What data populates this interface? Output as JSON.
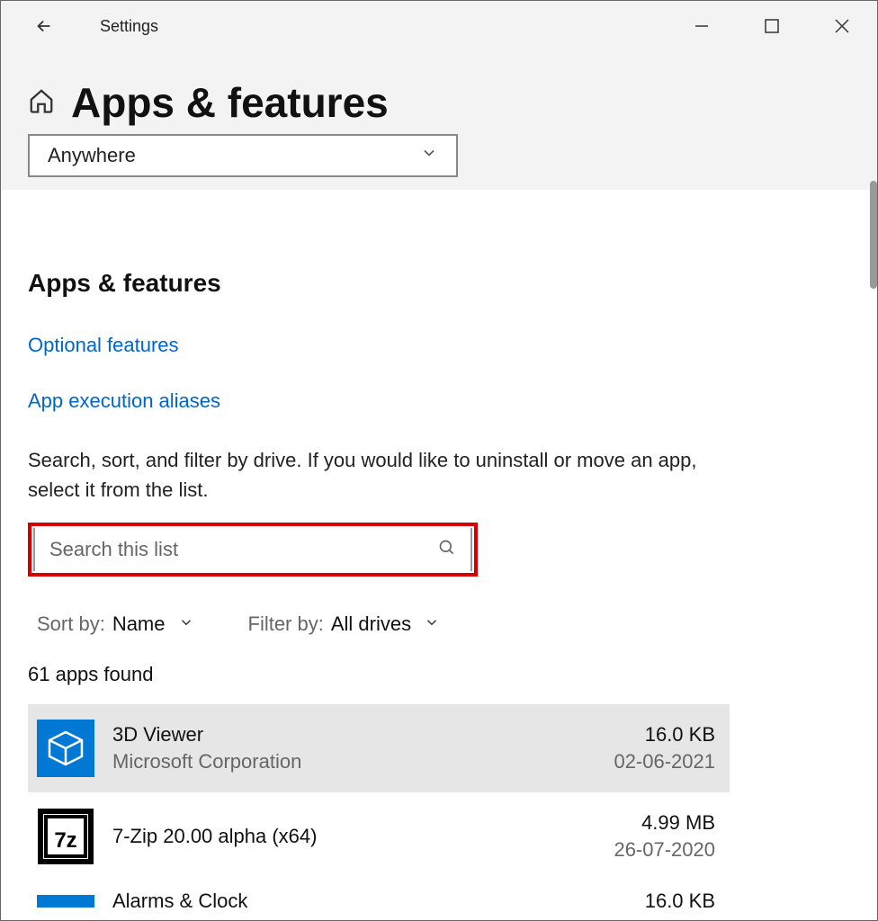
{
  "window": {
    "title": "Settings"
  },
  "page": {
    "title": "Apps & features"
  },
  "source_dropdown": {
    "value": "Anywhere"
  },
  "section": {
    "heading": "Apps & features",
    "link_optional": "Optional features",
    "link_aliases": "App execution aliases",
    "description": "Search, sort, and filter by drive. If you would like to uninstall or move an app, select it from the list."
  },
  "search": {
    "placeholder": "Search this list"
  },
  "sort": {
    "label": "Sort by:",
    "value": "Name"
  },
  "filter": {
    "label": "Filter by:",
    "value": "All drives"
  },
  "count_text": "61 apps found",
  "apps": [
    {
      "name": "3D Viewer",
      "publisher": "Microsoft Corporation",
      "size": "16.0 KB",
      "date": "02-06-2021",
      "icon": "cube-icon",
      "hover": true
    },
    {
      "name": "7-Zip 20.00 alpha (x64)",
      "publisher": "",
      "size": "4.99 MB",
      "date": "26-07-2020",
      "icon": "7z-icon",
      "hover": false
    }
  ],
  "partial": {
    "name": "Alarms & Clock",
    "size": "16.0 KB"
  }
}
